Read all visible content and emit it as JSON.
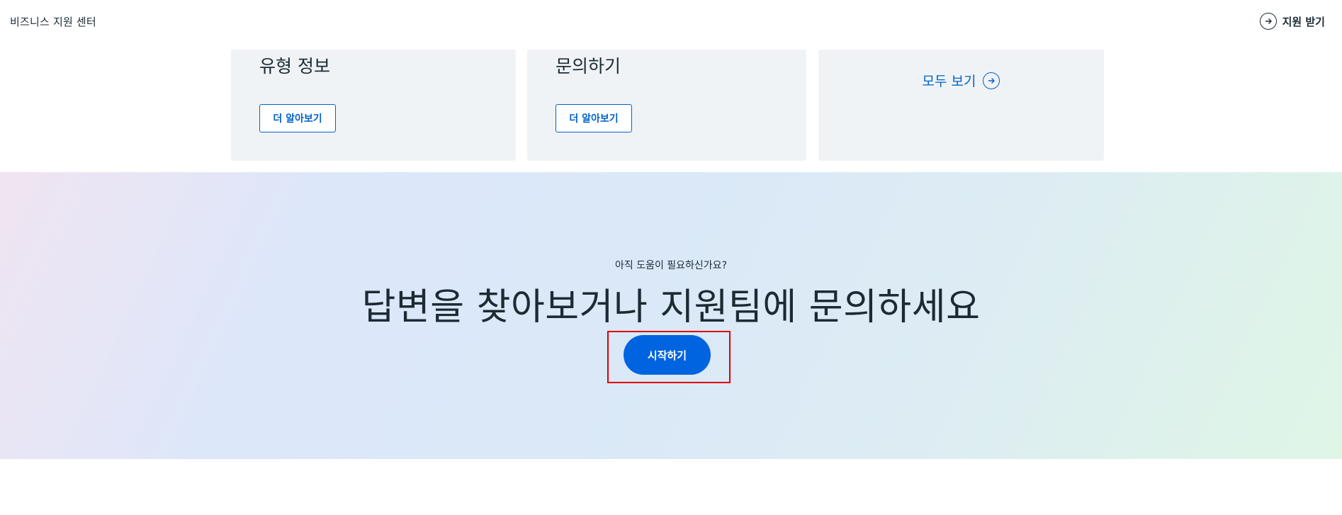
{
  "header": {
    "brand": "비즈니스 지원 센터",
    "support_label": "지원 받기"
  },
  "cards": [
    {
      "title": "유형 정보",
      "button_label": "더 알아보기"
    },
    {
      "title": "문의하기",
      "button_label": "더 알아보기"
    },
    {
      "link_label": "모두 보기"
    }
  ],
  "hero": {
    "subtitle": "아직 도움이 필요하신가요?",
    "title": "답변을 찾아보거나 지원팀에 문의하세요",
    "button_label": "시작하기"
  },
  "colors": {
    "accent": "#0064e0",
    "link": "#0062cc",
    "text": "#1c2b33",
    "card_bg": "#f0f3f6",
    "highlight": "#e00000"
  },
  "icons": {
    "support": "arrow-right-circle-icon",
    "see_all": "arrow-right-circle-icon"
  }
}
